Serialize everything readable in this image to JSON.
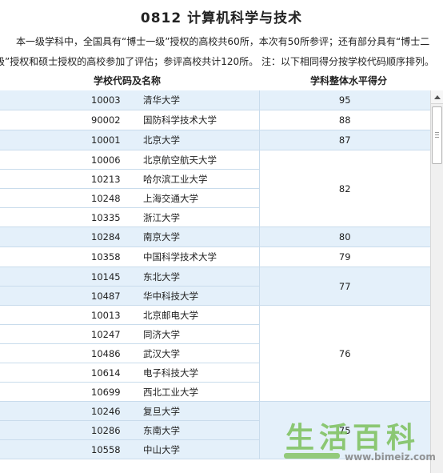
{
  "page": {
    "title": "0812  计算机科学与技术",
    "intro_line1": "本一级学科中，全国具有“博士一级”授权的高校共60所，本次有50所参评；还有部分具有“博士二",
    "intro_line2": "级”授权和硕士授权的高校参加了评估；参评高校共计120所。 注：以下相同得分按学校代码顺序排列。"
  },
  "table": {
    "header_code_name": "学校代码及名称",
    "header_score": "学科整体水平得分",
    "rows": [
      {
        "code": "10003",
        "name": "清华大学"
      },
      {
        "code": "90002",
        "name": "国防科学技术大学"
      },
      {
        "code": "10001",
        "name": "北京大学"
      },
      {
        "code": "10006",
        "name": "北京航空航天大学"
      },
      {
        "code": "10213",
        "name": "哈尔滨工业大学"
      },
      {
        "code": "10248",
        "name": "上海交通大学"
      },
      {
        "code": "10335",
        "name": "浙江大学"
      },
      {
        "code": "10284",
        "name": "南京大学"
      },
      {
        "code": "10358",
        "name": "中国科学技术大学"
      },
      {
        "code": "10145",
        "name": "东北大学"
      },
      {
        "code": "10487",
        "name": "华中科技大学"
      },
      {
        "code": "10013",
        "name": "北京邮电大学"
      },
      {
        "code": "10247",
        "name": "同济大学"
      },
      {
        "code": "10486",
        "name": "武汉大学"
      },
      {
        "code": "10614",
        "name": "电子科技大学"
      },
      {
        "code": "10699",
        "name": "西北工业大学"
      },
      {
        "code": "10246",
        "name": "复旦大学"
      },
      {
        "code": "10286",
        "name": "东南大学"
      },
      {
        "code": "10558",
        "name": "中山大学"
      }
    ],
    "score_groups": [
      {
        "score": "95",
        "rows": 1,
        "shaded": true
      },
      {
        "score": "88",
        "rows": 1,
        "shaded": false
      },
      {
        "score": "87",
        "rows": 1,
        "shaded": true
      },
      {
        "score": "82",
        "rows": 4,
        "shaded": false
      },
      {
        "score": "80",
        "rows": 1,
        "shaded": true
      },
      {
        "score": "79",
        "rows": 1,
        "shaded": false
      },
      {
        "score": "77",
        "rows": 2,
        "shaded": true
      },
      {
        "score": "76",
        "rows": 5,
        "shaded": false
      },
      {
        "score": "75",
        "rows": 3,
        "shaded": true
      }
    ]
  },
  "watermark": {
    "text": "生活百科",
    "url": "www.bimeiz.com"
  }
}
